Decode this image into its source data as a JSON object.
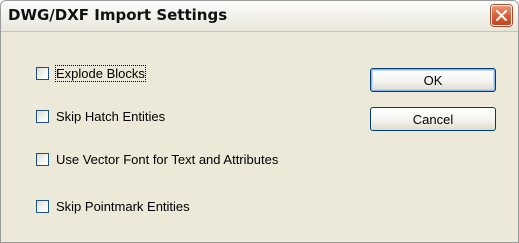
{
  "window": {
    "title": "DWG/DXF Import Settings",
    "close_icon": "close-icon"
  },
  "options": [
    {
      "label": "Explode Blocks",
      "checked": false,
      "focused": true
    },
    {
      "label": "Skip Hatch Entities",
      "checked": false
    },
    {
      "label": "Use Vector Font for Text and Attributes",
      "checked": false
    },
    {
      "label": "Skip Pointmark Entities",
      "checked": false
    }
  ],
  "buttons": {
    "ok_label": "OK",
    "cancel_label": "Cancel"
  },
  "colors": {
    "dialog_background": "#ece9d8",
    "close_button": "#d8603c",
    "button_border": "#003c74"
  }
}
